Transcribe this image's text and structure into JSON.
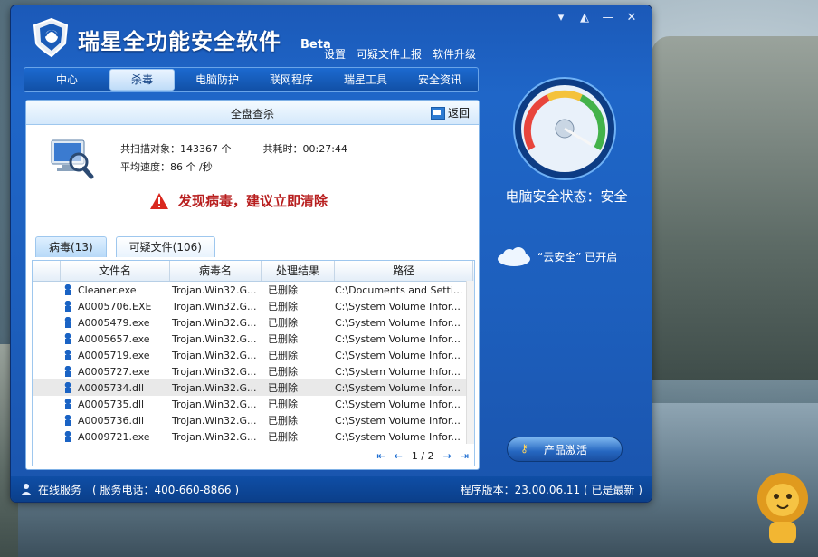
{
  "window": {
    "app_title": "瑞星全功能安全软件",
    "beta": "Beta",
    "controls": [
      "▾",
      "◭",
      "—",
      "✕"
    ]
  },
  "top_links": [
    "设置",
    "可疑文件上报",
    "软件升级"
  ],
  "nav": {
    "tabs": [
      {
        "label": "中心",
        "active": false
      },
      {
        "label": "杀毒",
        "active": true
      },
      {
        "label": "电脑防护",
        "active": false
      },
      {
        "label": "联网程序",
        "active": false
      },
      {
        "label": "瑞星工具",
        "active": false
      },
      {
        "label": "安全资讯",
        "active": false
      }
    ]
  },
  "panel": {
    "title": "全盘查杀",
    "back_label": "返回",
    "stats": {
      "scanned_label": "共扫描对象：143367 个",
      "elapsed_label": "共耗时：00:27:44",
      "speed_label": "平均速度：86 个 /秒"
    },
    "alert": "发现病毒，建议立即清除"
  },
  "subtabs": [
    {
      "label": "病毒(13)",
      "active": true
    },
    {
      "label": "可疑文件(106)",
      "active": false
    }
  ],
  "table": {
    "headers": [
      "文件名",
      "病毒名",
      "处理结果",
      "路径"
    ],
    "rows": [
      {
        "file": "Cleaner.exe",
        "virus": "Trojan.Win32.G...",
        "result": "已删除",
        "path": "C:\\Documents and Setti..."
      },
      {
        "file": "A0005706.EXE",
        "virus": "Trojan.Win32.G...",
        "result": "已删除",
        "path": "C:\\System Volume Infor..."
      },
      {
        "file": "A0005479.exe",
        "virus": "Trojan.Win32.G...",
        "result": "已删除",
        "path": "C:\\System Volume Infor..."
      },
      {
        "file": "A0005657.exe",
        "virus": "Trojan.Win32.G...",
        "result": "已删除",
        "path": "C:\\System Volume Infor..."
      },
      {
        "file": "A0005719.exe",
        "virus": "Trojan.Win32.G...",
        "result": "已删除",
        "path": "C:\\System Volume Infor..."
      },
      {
        "file": "A0005727.exe",
        "virus": "Trojan.Win32.G...",
        "result": "已删除",
        "path": "C:\\System Volume Infor..."
      },
      {
        "file": "A0005734.dll",
        "virus": "Trojan.Win32.G...",
        "result": "已删除",
        "path": "C:\\System Volume Infor..."
      },
      {
        "file": "A0005735.dll",
        "virus": "Trojan.Win32.G...",
        "result": "已删除",
        "path": "C:\\System Volume Infor..."
      },
      {
        "file": "A0005736.dll",
        "virus": "Trojan.Win32.G...",
        "result": "已删除",
        "path": "C:\\System Volume Infor..."
      },
      {
        "file": "A0009721.exe",
        "virus": "Trojan.Win32.G...",
        "result": "已删除",
        "path": "C:\\System Volume Infor..."
      }
    ],
    "selected_row_index": 6,
    "pager": "1 / 2"
  },
  "right": {
    "status": "电脑安全状态：安全",
    "cloud": "“云安全” 已开启",
    "activate": "产品激活"
  },
  "statusbar": {
    "online": "在线服务",
    "phone": "( 服务电话：400-660-8866 )",
    "version": "程序版本：23.00.06.11 ( 已是最新 )"
  },
  "colors": {
    "accent": "#1f66c8",
    "alert_red": "#b81f1f",
    "status_bar": "#0f4ea6"
  }
}
